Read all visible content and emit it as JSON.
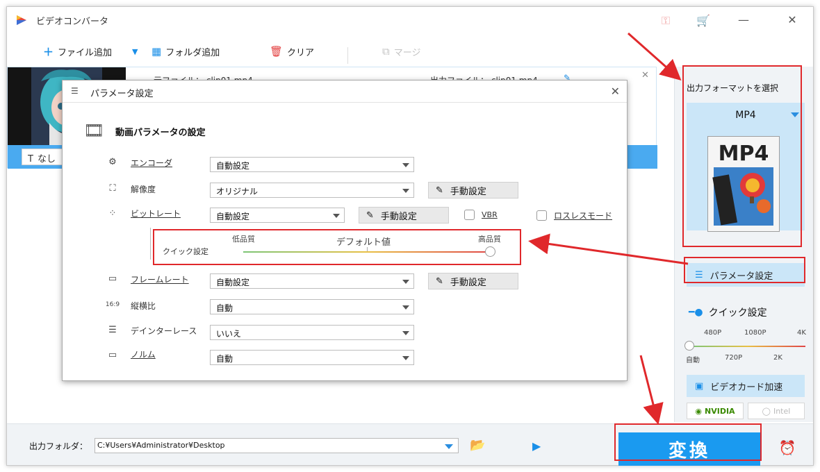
{
  "app": {
    "title": "ビデオコンバータ"
  },
  "toolbar": {
    "add_file": "ファイル追加",
    "add_folder": "フォルダ追加",
    "clear": "クリア",
    "merge": "マージ"
  },
  "file": {
    "source_prefix": "元ファイル：",
    "source_name": "clip01.mp4",
    "output_prefix": "出力ファイル：",
    "output_name": "clip01.mp4",
    "subtitle": "なし"
  },
  "right_panel": {
    "format_label": "出力フォーマットを選択",
    "format_name": "MP4",
    "format_icon_text": "MP4",
    "param_button": "パラメータ設定",
    "quick_title": "クイック設定",
    "ticks_top": [
      "480P",
      "1080P",
      "4K"
    ],
    "ticks_bottom": [
      "自動",
      "720P",
      "2K"
    ],
    "gpu_button": "ビデオカード加速",
    "nvidia": "NVIDIA",
    "intel": "Intel"
  },
  "bottom": {
    "output_label": "出力フォルダ：",
    "output_path": "C:¥Users¥Administrator¥Desktop",
    "convert": "変換"
  },
  "dialog": {
    "title": "パラメータ設定",
    "header": "動画パラメータの設定",
    "rows": {
      "encoder": {
        "label": "エンコーダ",
        "value": "自動設定"
      },
      "resolution": {
        "label": "解像度",
        "value": "オリジナル"
      },
      "bitrate": {
        "label": "ビットレート",
        "value": "自動設定"
      },
      "framerate": {
        "label": "フレームレート",
        "value": "自動設定"
      },
      "aspect": {
        "label": "縦横比",
        "value": "自動",
        "icon": "16:9"
      },
      "deinterlace": {
        "label": "デインターレース",
        "value": "いいえ"
      },
      "norm": {
        "label": "ノルム",
        "value": "自動"
      }
    },
    "manual": "手動設定",
    "vbr": "VBR",
    "lossless": "ロスレスモード",
    "quick": {
      "label": "クイック設定",
      "low": "低品質",
      "default": "デフォルト値",
      "high": "高品質"
    }
  }
}
